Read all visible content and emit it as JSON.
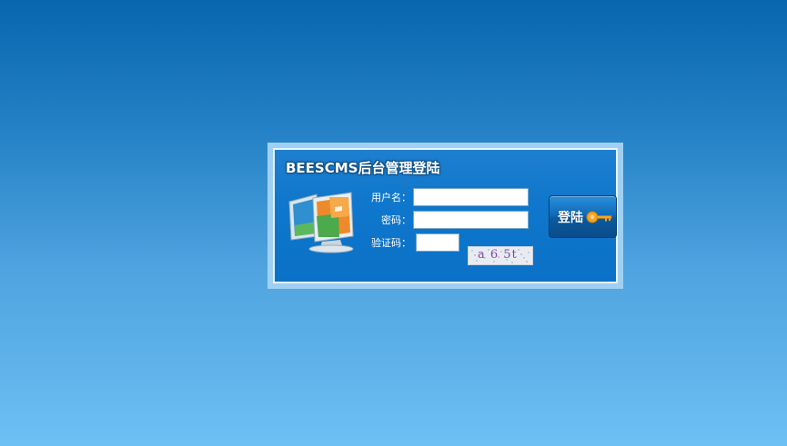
{
  "login": {
    "title": "BEESCMS后台管理登陆",
    "username_label": "用户名：",
    "password_label": "密码：",
    "captcha_label": "验证码：",
    "username_value": "",
    "password_value": "",
    "captcha_value": "",
    "captcha_text": "a 6 5t",
    "submit_label": "登陆"
  },
  "icons": {
    "panel_icon": "computer-monitor-icon",
    "button_icon": "key-icon"
  },
  "colors": {
    "panel_blue": "#0f77cc",
    "frame_light": "#9fd0f3",
    "background_top": "#0766ae",
    "background_bottom": "#6cc0f4"
  }
}
